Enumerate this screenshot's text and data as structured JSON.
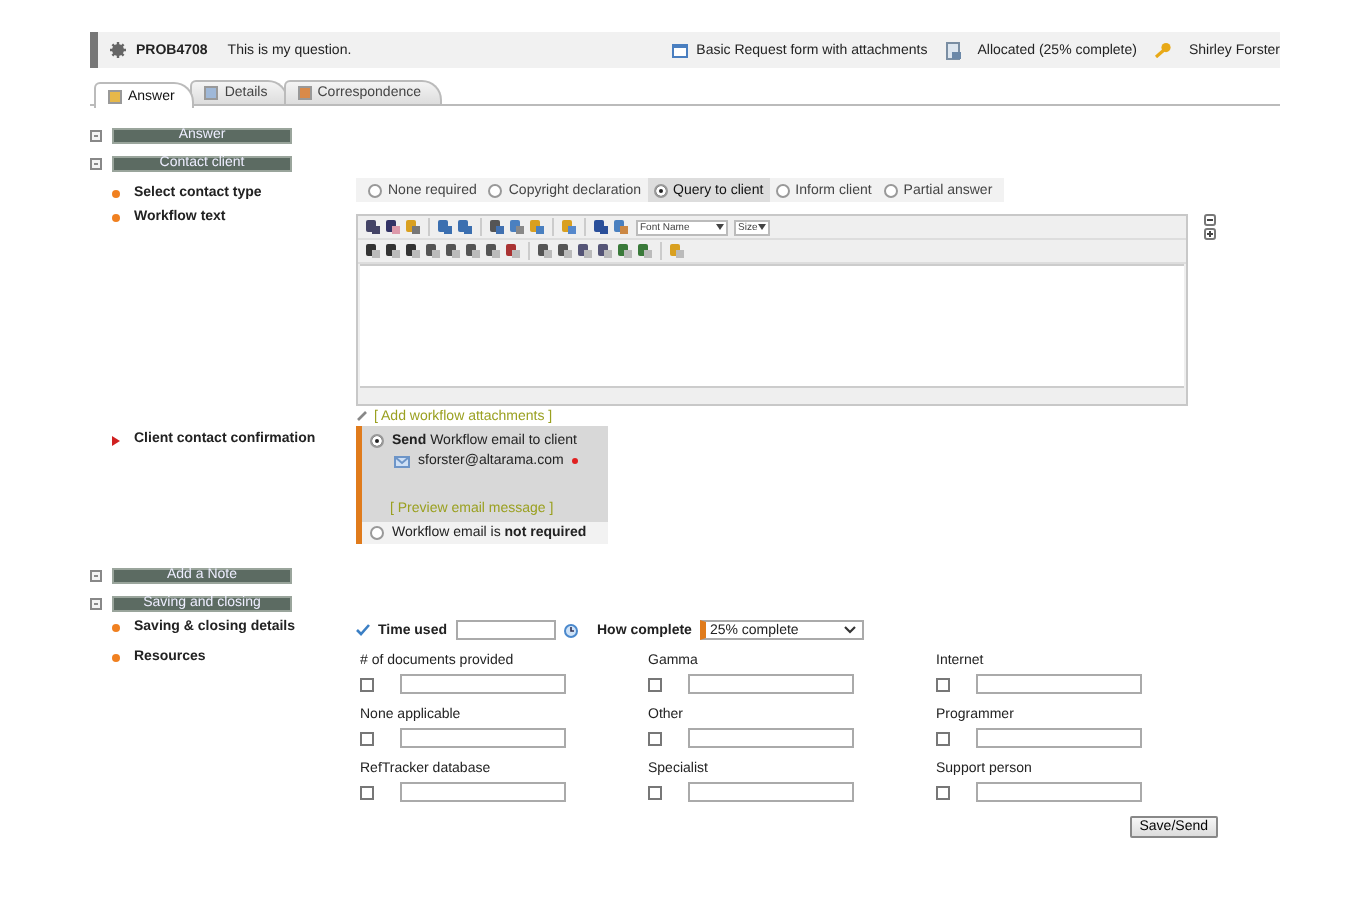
{
  "header": {
    "id": "PROB4708",
    "question": "This is my question.",
    "form": "Basic Request form with attachments",
    "status": "Allocated (25% complete)",
    "user": "Shirley Forster"
  },
  "tabs": [
    {
      "label": "Answer",
      "selected": true
    },
    {
      "label": "Details",
      "selected": false
    },
    {
      "label": "Correspondence",
      "selected": false
    }
  ],
  "sections": [
    {
      "title": "Answer"
    },
    {
      "title": "Contact client"
    }
  ],
  "contact_client": {
    "select_label": "Select contact type",
    "options": [
      {
        "label": "None required",
        "selected": false
      },
      {
        "label": "Copyright declaration",
        "selected": false
      },
      {
        "label": "Query to client",
        "selected": true
      },
      {
        "label": "Inform client",
        "selected": false
      },
      {
        "label": "Partial answer",
        "selected": false
      }
    ],
    "workflow_label": "Workflow text",
    "editor": {
      "font_name": "Font Name",
      "size": "Size"
    },
    "attachments_link": "[ Add workflow attachments ]",
    "confirmation_label": "Client contact confirmation",
    "send": {
      "text": "**Send** Workflow email to client",
      "email": "sforster@altarama.com",
      "preview_link": "[ Preview email message ]",
      "selected": true
    },
    "not_required": {
      "text": "Workflow email is **not required**",
      "selected": false
    }
  },
  "more_sections": [
    {
      "title": "Add a Note"
    },
    {
      "title": "Saving and closing"
    }
  ],
  "saving": {
    "details_label": "Saving & closing details",
    "time_used_label": "Time used",
    "how_complete_label": "How complete",
    "how_complete": "25% complete",
    "resources_label": "Resources",
    "resources": [
      {
        "label": "# of documents provided",
        "checked": false
      },
      {
        "label": "Gamma",
        "checked": false
      },
      {
        "label": "Internet",
        "checked": false
      },
      {
        "label": "None applicable",
        "checked": false
      },
      {
        "label": "Other",
        "checked": false
      },
      {
        "label": "Programmer",
        "checked": false
      },
      {
        "label": "RefTracker database",
        "checked": false
      },
      {
        "label": "Specialist",
        "checked": false
      },
      {
        "label": "Support person",
        "checked": false
      }
    ],
    "save_button": "Save/Send"
  }
}
